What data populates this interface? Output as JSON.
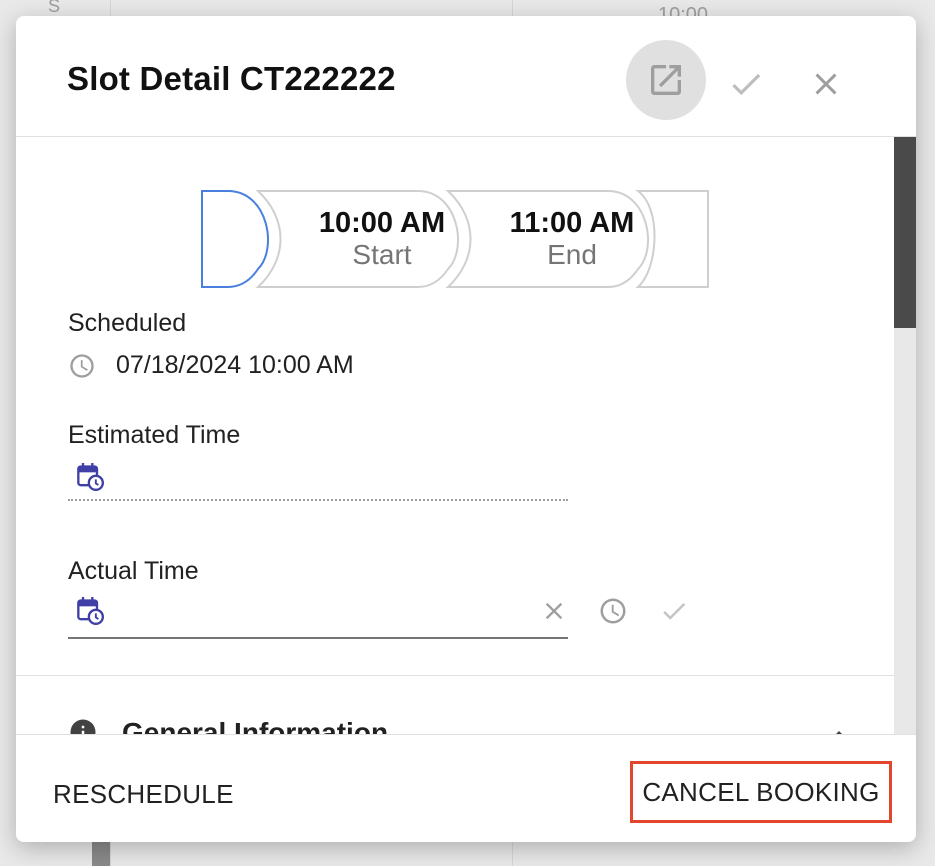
{
  "background": {
    "column_letter": "S",
    "time_label": "10:00"
  },
  "dialog": {
    "title": "Slot Detail CT222222",
    "header_actions": {
      "open_icon": "open-in-new-icon",
      "confirm_icon": "check-icon",
      "close_icon": "close-icon"
    },
    "stepper": {
      "start": {
        "time": "10:00 AM",
        "label": "Start"
      },
      "end": {
        "time": "11:00 AM",
        "label": "End"
      },
      "active_color": "#4a7fe0"
    },
    "scheduled": {
      "label": "Scheduled",
      "value": "07/18/2024 10:00 AM"
    },
    "estimated_time": {
      "label": "Estimated Time",
      "value": ""
    },
    "actual_time": {
      "label": "Actual Time",
      "value": ""
    },
    "general_section": {
      "title": "General Information"
    },
    "footer": {
      "reschedule_label": "RESCHEDULE",
      "cancel_label": "CANCEL BOOKING",
      "highlight_color": "#e2462c"
    }
  }
}
